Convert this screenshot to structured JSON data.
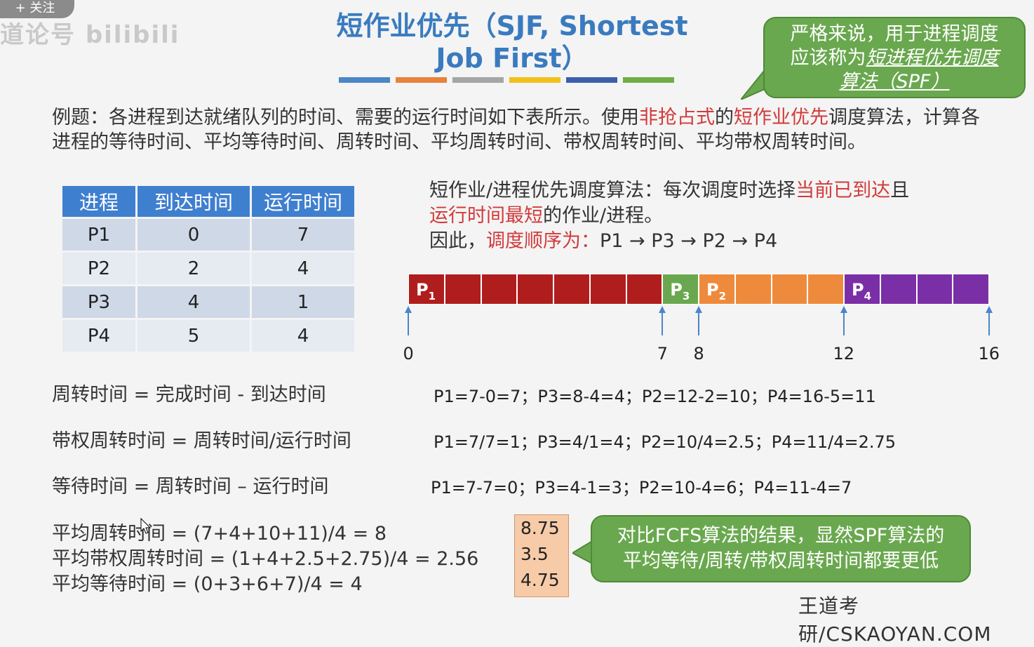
{
  "overlay": {
    "follow_label": "+ 关注",
    "watermark_text": "道论号 bilibili"
  },
  "title": {
    "line1": "短作业优先（SJF, Shortest",
    "line2": "Job First）",
    "bar_colors": [
      "#4a86c8",
      "#e8823a",
      "#a5a5a5",
      "#f2c01b",
      "#3b5fad",
      "#70ad47"
    ]
  },
  "callout_spf": {
    "line1": "严格来说，用于进程调度",
    "line2_plain": "应该称为",
    "line2_em": "短进程优先调度",
    "line3_em": "算法（SPF）"
  },
  "intro": {
    "part1": "例题：各进程到达就绪队列的时间、需要的运行时间如下表所示。使用",
    "red1": "非抢占式",
    "part2": "的",
    "red2": "短作业优先",
    "part3": "调度算法，计算各进程的等待时间、平均等待时间、周转时间、平均周转时间、带权周转时间、平均带权周转时间。"
  },
  "table": {
    "headers": [
      "进程",
      "到达时间",
      "运行时间"
    ],
    "rows": [
      [
        "P1",
        "0",
        "7"
      ],
      [
        "P2",
        "2",
        "4"
      ],
      [
        "P3",
        "4",
        "1"
      ],
      [
        "P4",
        "5",
        "4"
      ]
    ]
  },
  "explain": {
    "l1_plain": "短作业/进程优先调度算法：每次调度时选择",
    "l1_red": "当前已到达",
    "l1_tail": "且",
    "l2_red": "运行时间最短",
    "l2_tail": "的作业/进程。",
    "l3_plain": "因此，",
    "l3_red": "调度顺序为：",
    "l3_order": "P1 → P3 → P2 → P4"
  },
  "gantt": {
    "segments": [
      {
        "label": "P",
        "sub": "1",
        "start": 0,
        "end": 7,
        "color": "#b01d1d"
      },
      {
        "label": "P",
        "sub": "3",
        "start": 7,
        "end": 8,
        "color": "#6aa84f"
      },
      {
        "label": "P",
        "sub": "2",
        "start": 8,
        "end": 12,
        "color": "#ee8a3c"
      },
      {
        "label": "P",
        "sub": "4",
        "start": 12,
        "end": 16,
        "color": "#7a2fa6"
      }
    ],
    "ticks": [
      "0",
      "7",
      "8",
      "12",
      "16"
    ],
    "tick_values": [
      0,
      7,
      8,
      12,
      16
    ],
    "total": 16
  },
  "formulas": {
    "turnaround": "周转时间 = 完成时间 - 到达时间",
    "turnaround_calc": "P1=7-0=7；P3=8-4=4；P2=12-2=10；P4=16-5=11",
    "weighted": "带权周转时间 = 周转时间/运行时间",
    "weighted_calc": "P1=7/7=1；P3=4/1=4；P2=10/4=2.5；P4=11/4=2.75",
    "waiting": "等待时间 = 周转时间 – 运行时间",
    "waiting_calc": "P1=7-7=0；P3=4-1=3；P2=10-4=6；P4=11-4=7",
    "avg_turnaround": "平均周转时间 = (7+4+10+11)/4 = 8",
    "avg_weighted": "平均带权周转时间 = (1+4+2.5+2.75)/4 = 2.56",
    "avg_waiting": "平均等待时间 = (0+3+6+7)/4 = 4"
  },
  "avg_box": [
    "8.75",
    "3.5",
    "4.75"
  ],
  "callout_compare": {
    "line1": "对比FCFS算法的结果，显然SPF算法的",
    "line2": "平均等待/周转/带权周转时间都要更低"
  },
  "footer": "王道考研/CSKAOYAN.COM"
}
